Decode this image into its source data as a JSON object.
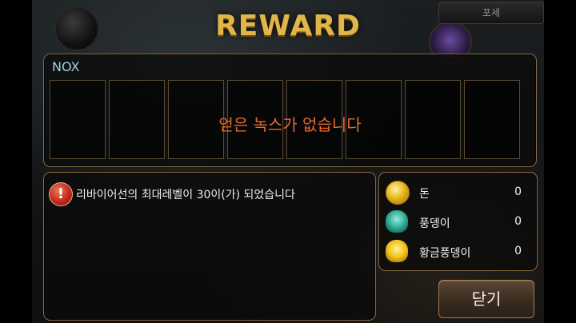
{
  "title": "REWARD",
  "top_tab_label": "포세",
  "nox": {
    "label": "NOX",
    "slot_count": 8,
    "empty_message": "얻은 녹스가 없습니다"
  },
  "message": {
    "icon": "warning-icon",
    "text": "리바이어선의 최대레벨이 30이(가) 되었습니다"
  },
  "rewards": [
    {
      "icon": "gold-coin-icon",
      "label": "돈",
      "value": "0"
    },
    {
      "icon": "green-beetle-icon",
      "label": "풍뎅이",
      "value": "0"
    },
    {
      "icon": "golden-beetle-icon",
      "label": "황금풍뎅이",
      "value": "0"
    }
  ],
  "close_button": "닫기",
  "colors": {
    "title_gold": "#e0b64a",
    "nox_label": "#9ed0da",
    "empty_message": "#e36a2c",
    "panel_border": "#8a6a44"
  }
}
